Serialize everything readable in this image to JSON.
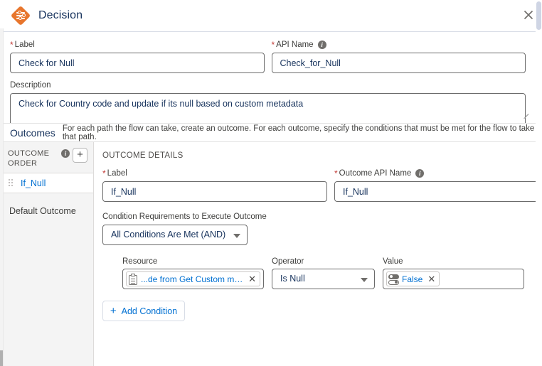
{
  "header": {
    "title": "Decision",
    "icon": "decision-diamond-icon",
    "close_label": "×",
    "accent_color": "#e8762d"
  },
  "top_form": {
    "label_field": {
      "label": "Label",
      "required": true,
      "value": "Check for Null"
    },
    "api_name_field": {
      "label": "API Name",
      "required": true,
      "value": "Check_for_Null",
      "has_info_icon": true
    },
    "description_field": {
      "label": "Description",
      "required": false,
      "value": "Check for Country code and update if its null based on custom metadata"
    }
  },
  "outcomes_strip": {
    "heading": "Outcomes",
    "subtext": "For each path the flow can take, create an outcome. For each outcome, specify the conditions that must be met for the flow to take that path."
  },
  "sidebar": {
    "title": "OUTCOME ORDER",
    "has_info_icon": true,
    "add_button_label": "+",
    "items": [
      {
        "label": "If_Null",
        "selected": true,
        "draggable": true
      },
      {
        "label": "Default Outcome",
        "selected": false,
        "draggable": false
      }
    ]
  },
  "outcome_details": {
    "section_title": "OUTCOME DETAILS",
    "label_field": {
      "label": "Label",
      "required": true,
      "value": "If_Null"
    },
    "api_name_field": {
      "label": "Outcome API Name",
      "required": true,
      "value": "If_Null",
      "has_info_icon": true
    },
    "condition_requirements": {
      "label": "Condition Requirements to Execute Outcome",
      "selected": "All Conditions Are Met (AND)"
    },
    "condition_columns": {
      "resource": "Resource",
      "operator": "Operator",
      "value": "Value"
    },
    "conditions": [
      {
        "resource": {
          "text": "...de from Get Custom metadata",
          "icon": "record-clipboard-icon",
          "remove_label": "✕"
        },
        "operator": "Is Null",
        "value": {
          "text": "False",
          "icon": "boolean-toggle-icon",
          "remove_label": "✕"
        },
        "delete_icon": "trash-icon"
      }
    ],
    "add_condition_label": "Add Condition"
  }
}
